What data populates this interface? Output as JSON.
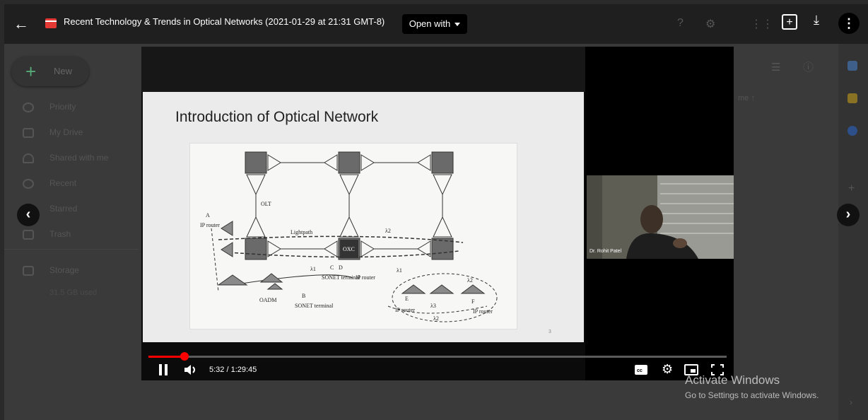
{
  "header": {
    "title": "Recent Technology & Trends in Optical Networks (2021-01-29 at 21:31 GMT-8)",
    "open_with": "Open with"
  },
  "sidebar": {
    "new_label": "New",
    "items": [
      {
        "label": "Priority",
        "icon": "check-circle-icon"
      },
      {
        "label": "My Drive",
        "icon": "drive-icon"
      },
      {
        "label": "Shared with me",
        "icon": "people-icon"
      },
      {
        "label": "Recent",
        "icon": "clock-icon"
      },
      {
        "label": "Starred",
        "icon": "star-icon"
      },
      {
        "label": "Trash",
        "icon": "trash-icon"
      }
    ],
    "storage_label": "Storage",
    "storage_used": "31.5 GB used"
  },
  "background_column": "me",
  "slide": {
    "title": "Introduction of Optical Network",
    "labels": [
      "OLT",
      "Lightpath",
      "λ2",
      "λ1",
      "λ1",
      "OXC",
      "IP router",
      "A",
      "B",
      "C",
      "D",
      "E",
      "F",
      "SONET terminal",
      "IP router",
      "OADM",
      "SONET terminal",
      "IP router",
      "IP router",
      "λ2",
      "λ3",
      "λ2"
    ],
    "page_number": "3"
  },
  "webcam": {
    "name": "Dr. Rohit Patel"
  },
  "player": {
    "time": "5:32 / 1:29:45",
    "progress": 0.062,
    "icons": [
      "pause-icon",
      "volume-icon",
      "captions-icon",
      "settings-icon",
      "miniplayer-icon",
      "fullscreen-icon"
    ]
  },
  "watermark": {
    "line1": "Activate Windows",
    "line2": "Go to Settings to activate Windows."
  }
}
